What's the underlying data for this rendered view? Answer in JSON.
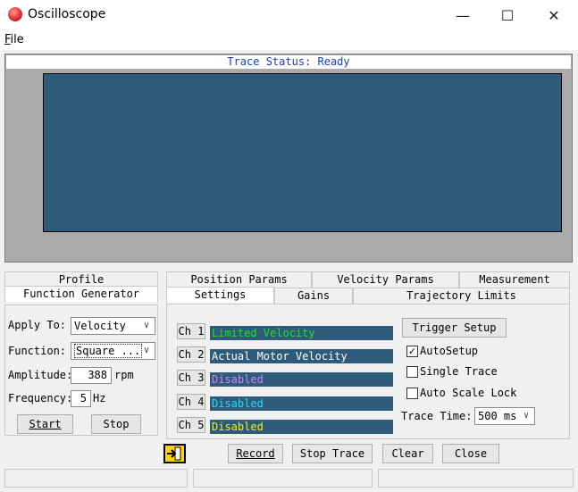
{
  "window": {
    "title": "Oscilloscope",
    "minimize": "—",
    "maximize": "☐",
    "close": "✕"
  },
  "menu": {
    "file_label": "File"
  },
  "scope": {
    "trace_status": "Trace Status:  Ready"
  },
  "left_tabs": {
    "profile": "Profile",
    "function_generator": "Function Generator"
  },
  "function_generator": {
    "apply_to_label": "Apply To:",
    "apply_to_value": "Velocity",
    "function_label": "Function:",
    "function_value": "Square ...",
    "amplitude_label": "Amplitude:",
    "amplitude_value": "388",
    "amplitude_unit": "rpm",
    "frequency_label": "Frequency:",
    "frequency_value": "5",
    "frequency_unit": "Hz",
    "start_label": "Start",
    "stop_label": "Stop"
  },
  "right_tabs": {
    "position_params": "Position Params",
    "velocity_params": "Velocity Params",
    "measurement": "Measurement",
    "settings": "Settings",
    "gains": "Gains",
    "trajectory_limits": "Trajectory Limits"
  },
  "channels": [
    {
      "label": "Ch 1",
      "value": "Limited Velocity",
      "color": "#20e020"
    },
    {
      "label": "Ch 2",
      "value": "Actual Motor Velocity",
      "color": "#ffffff"
    },
    {
      "label": "Ch 3",
      "value": "Disabled",
      "color": "#d080ff"
    },
    {
      "label": "Ch 4",
      "value": "Disabled",
      "color": "#20e0f0"
    },
    {
      "label": "Ch 5",
      "value": "Disabled",
      "color": "#f0f020"
    }
  ],
  "settings": {
    "trigger_setup_label": "Trigger Setup",
    "autosetup_label": "AutoSetup",
    "autosetup_checked": true,
    "single_trace_label": "Single Trace",
    "single_trace_checked": false,
    "auto_scale_lock_label": "Auto Scale Lock",
    "auto_scale_lock_checked": false,
    "trace_time_label": "Trace Time:",
    "trace_time_value": "500 ms"
  },
  "bottom_buttons": {
    "record": "Record",
    "stop_trace": "Stop Trace",
    "clear": "Clear",
    "close": "Close"
  },
  "icons": {
    "export": "export-icon"
  }
}
